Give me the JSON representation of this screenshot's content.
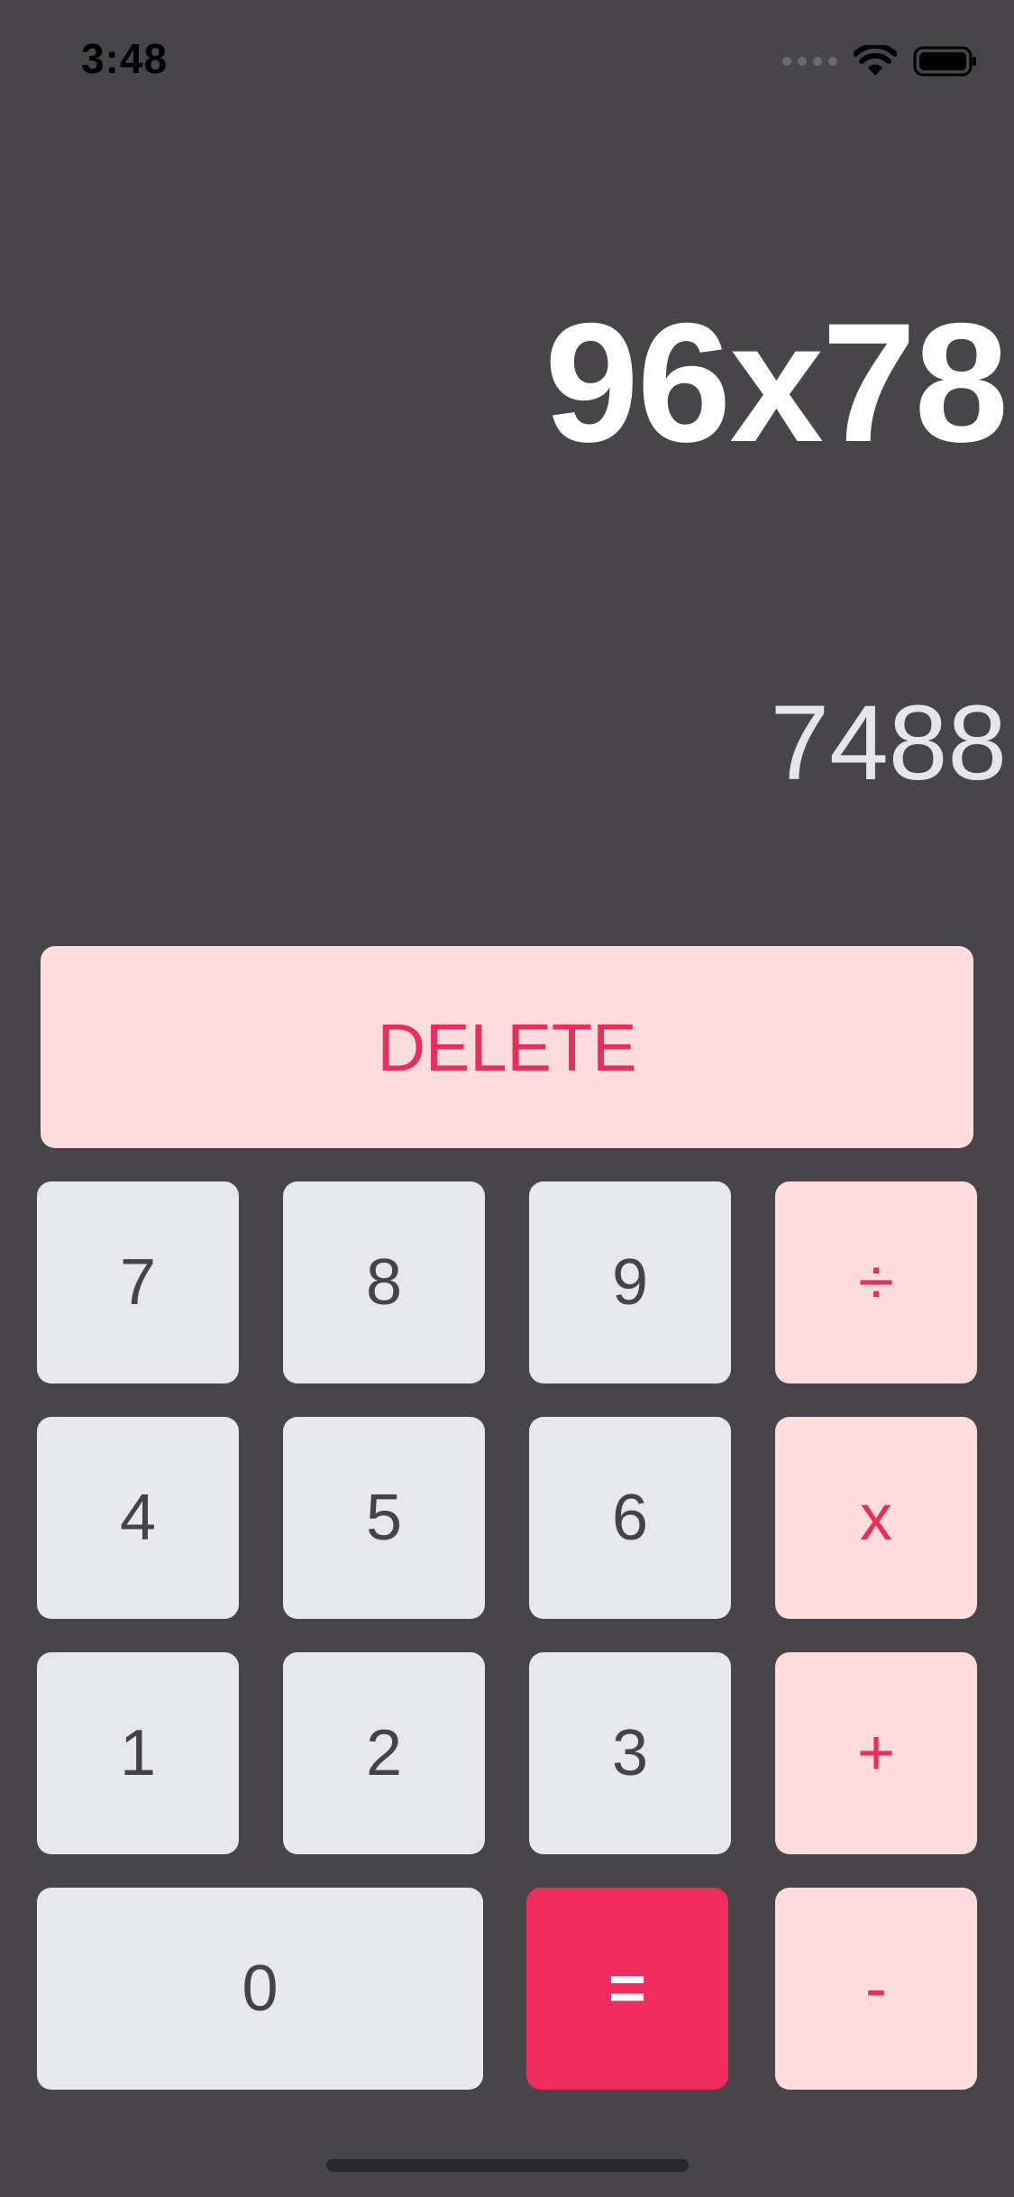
{
  "status_bar": {
    "time": "3:48"
  },
  "display": {
    "expression": "96x78",
    "result": "7488"
  },
  "keypad": {
    "delete": "DELETE",
    "row1": [
      "7",
      "8",
      "9",
      "÷"
    ],
    "row2": [
      "4",
      "5",
      "6",
      "x"
    ],
    "row3": [
      "1",
      "2",
      "3",
      "+"
    ],
    "row4": [
      "0",
      "=",
      "-"
    ]
  },
  "colors": {
    "background": "#47454a",
    "number_key": "#e7e8ec",
    "operator_key": "#fcdcdd",
    "accent": "#ee2d5d"
  }
}
